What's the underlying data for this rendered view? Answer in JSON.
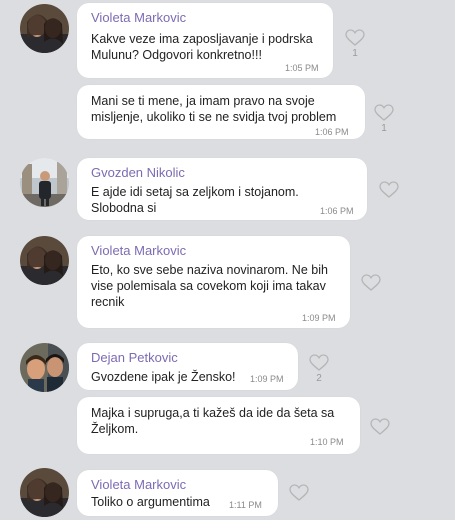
{
  "messages": [
    {
      "sender": "Violeta Markovic",
      "text": "Kakve veze ima zaposljavanje i podrska\nMulunu? Odgovori konkretno!!!",
      "time": "1:05 PM",
      "likes": "1"
    },
    {
      "sender": "",
      "text": "Mani se ti mene, ja imam pravo na svoje\nmisljenje, ukoliko ti se ne svidja tvoj problem",
      "time": "1:06 PM",
      "likes": "1"
    },
    {
      "sender": "Gvozden Nikolic",
      "text": "E ajde idi setaj sa zeljkom i stojanom.\nSlobodna si",
      "time": "1:06 PM",
      "likes": ""
    },
    {
      "sender": "Violeta Markovic",
      "text": "Eto, ko sve sebe naziva novinarom. Ne bih\nvise polemisala sa covekom koji ima takav\nrecnik",
      "time": "1:09 PM",
      "likes": ""
    },
    {
      "sender": "Dejan Petkovic",
      "text": "Gvozdene ipak je Žensko!",
      "time": "1:09 PM",
      "likes": "2"
    },
    {
      "sender": "",
      "text": "Majka i supruga,a ti kažeš da ide da šeta sa\nŽeljkom.",
      "time": "1:10 PM",
      "likes": ""
    },
    {
      "sender": "Violeta Markovic",
      "text": "Toliko o argumentima",
      "time": "1:11 PM",
      "likes": ""
    }
  ],
  "colors": {
    "background": "#dcdde0",
    "bubble": "#ffffff",
    "sender_name": "#7d6bb3",
    "timestamp": "#8a8a8a",
    "like_icon": "#b5b5b5"
  }
}
